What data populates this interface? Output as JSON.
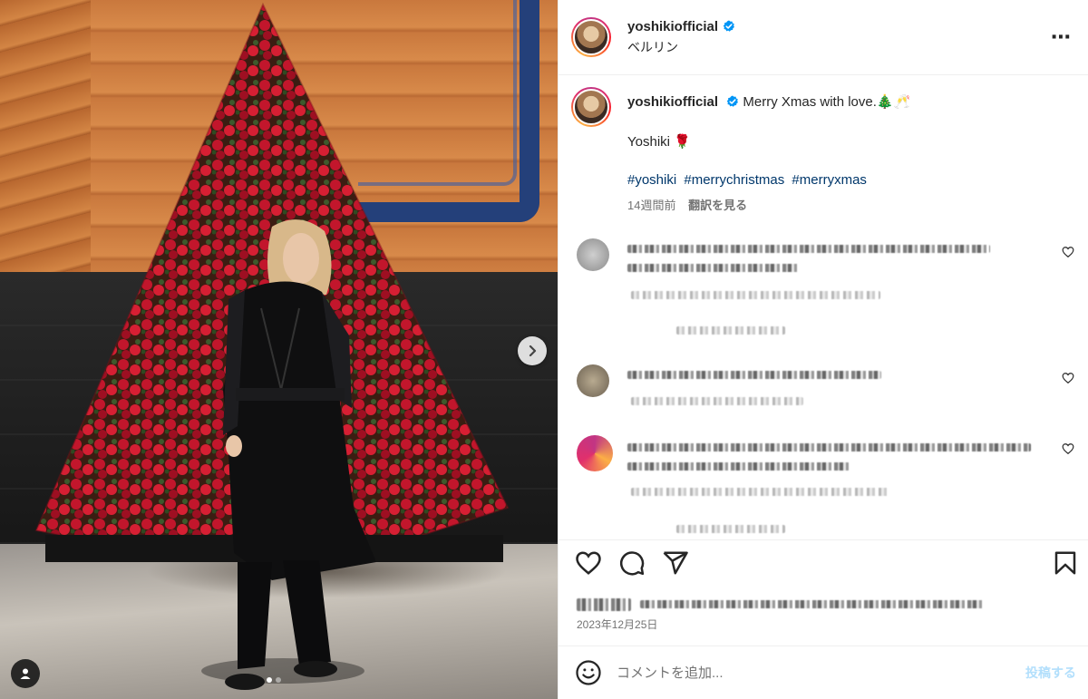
{
  "post": {
    "username": "yoshikiofficial",
    "location": "ベルリン",
    "caption_text": "Merry Xmas with love.🎄🥂",
    "caption_signature": "Yoshiki 🌹",
    "hashtags": [
      "#yoshiki",
      "#merrychristmas",
      "#merryxmas"
    ],
    "time_ago": "14週間前",
    "translate_label": "翻訳を見る",
    "date": "2023年12月25日"
  },
  "more_icon": "⋯",
  "comment_box": {
    "placeholder": "コメントを追加...",
    "post_label": "投稿する"
  },
  "icons": [
    "verified-badge-icon",
    "more-options-icon",
    "next-arrow-icon",
    "user-tag-icon",
    "heart-icon",
    "comment-icon",
    "share-icon",
    "bookmark-icon",
    "emoji-icon"
  ],
  "colors": {
    "verified": "#0095f6",
    "hashtag": "#00376b",
    "post_button_disabled": "#b2dffc"
  }
}
